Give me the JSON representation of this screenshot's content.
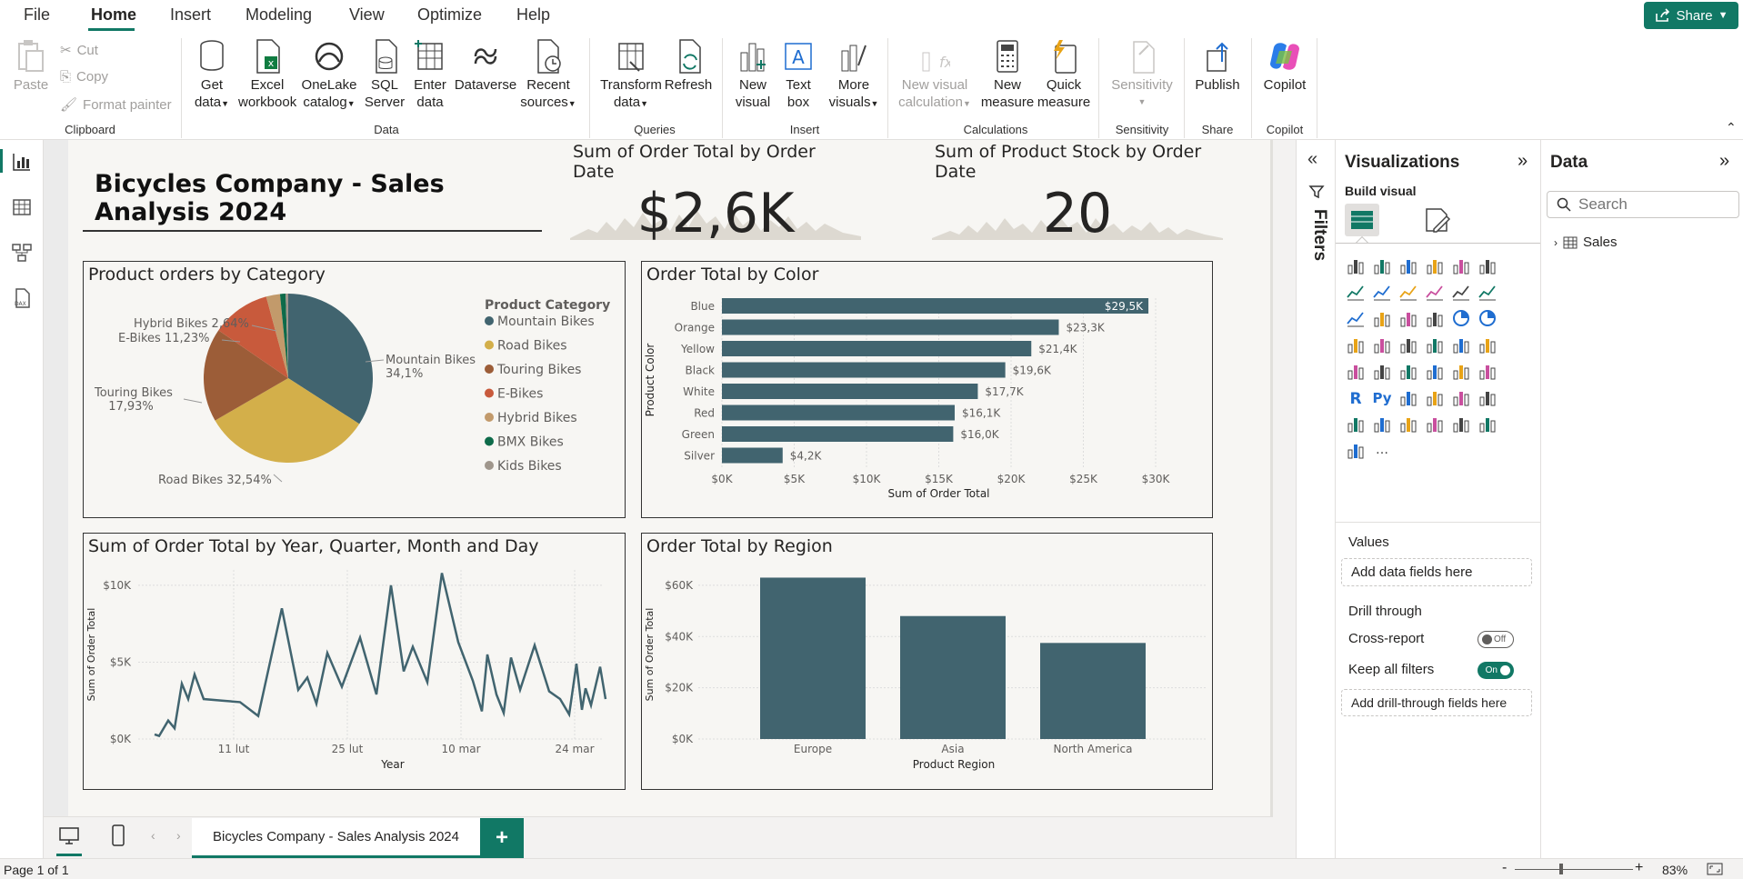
{
  "menu": {
    "file": "File",
    "home": "Home",
    "insert": "Insert",
    "modeling": "Modeling",
    "view": "View",
    "optimize": "Optimize",
    "help": "Help",
    "share": "Share"
  },
  "ribbon": {
    "paste": "Paste",
    "cut": "Cut",
    "copy": "Copy",
    "format_painter": "Format painter",
    "get_data": [
      "Get",
      "data"
    ],
    "excel": [
      "Excel",
      "workbook"
    ],
    "onelake": [
      "OneLake",
      "catalog"
    ],
    "sql": [
      "SQL",
      "Server"
    ],
    "enter": [
      "Enter",
      "data"
    ],
    "dataverse": "Dataverse",
    "recent": [
      "Recent",
      "sources"
    ],
    "transform": [
      "Transform",
      "data"
    ],
    "refresh": "Refresh",
    "new_visual": [
      "New",
      "visual"
    ],
    "text_box": [
      "Text",
      "box"
    ],
    "more_visuals": [
      "More",
      "visuals"
    ],
    "new_visual_calc": [
      "New visual",
      "calculation"
    ],
    "new_measure": [
      "New",
      "measure"
    ],
    "quick_measure": [
      "Quick",
      "measure"
    ],
    "sensitivity": "Sensitivity",
    "publish": "Publish",
    "copilot": "Copilot",
    "groups": {
      "clipboard": "Clipboard",
      "data": "Data",
      "queries": "Queries",
      "insert": "Insert",
      "calculations": "Calculations",
      "sensitivity": "Sensitivity",
      "share": "Share",
      "copilot": "Copilot"
    }
  },
  "report": {
    "title": "Bicycles Company - Sales Analysis 2024",
    "card1": {
      "title": "Sum of Order Total by Order Date",
      "value": "$2,6K"
    },
    "card2": {
      "title": "Sum of Product Stock by Order Date",
      "value": "20"
    },
    "pie_title": "Product orders by Category",
    "bar_title": "Order Total by Color",
    "line_title": "Sum of Order Total by Year, Quarter, Month and Day",
    "region_title": "Order Total by Region"
  },
  "chart_data": [
    {
      "type": "pie",
      "title": "Product orders by Category",
      "legend_title": "Product Category",
      "categories": [
        "Mountain Bikes",
        "Road Bikes",
        "Touring Bikes",
        "E-Bikes",
        "Hybrid Bikes",
        "BMX Bikes",
        "Kids Bikes"
      ],
      "values": [
        34.1,
        32.54,
        17.93,
        11.23,
        2.64,
        1.06,
        0.5
      ],
      "labels": [
        "Mountain Bikes 34,1%",
        "Road Bikes 32,54%",
        "Touring Bikes 17,93%",
        "E-Bikes 11,23%",
        "Hybrid Bikes 2,64%"
      ],
      "colors": [
        "#41646f",
        "#d3af4a",
        "#9c5d38",
        "#c85a3c",
        "#c29a6b",
        "#0e6b4a",
        "#9f968c"
      ],
      "legend": "right"
    },
    {
      "type": "bar",
      "orientation": "horizontal",
      "title": "Order Total by Color",
      "categories": [
        "Blue",
        "Orange",
        "Yellow",
        "Black",
        "White",
        "Red",
        "Green",
        "Silver"
      ],
      "values": [
        29.5,
        23.3,
        21.4,
        19.6,
        17.7,
        16.1,
        16.0,
        4.2
      ],
      "labels": [
        "$29,5K",
        "$23,3K",
        "$21,4K",
        "$19,6K",
        "$17,7K",
        "$16,1K",
        "$16,0K",
        "$4,2K"
      ],
      "xlabel": "Sum of Order Total",
      "ylabel": "Product Color",
      "xticks": [
        "$0K",
        "$5K",
        "$10K",
        "$15K",
        "$20K",
        "$25K",
        "$30K"
      ],
      "xlim": [
        0,
        30
      ]
    },
    {
      "type": "line",
      "title": "Sum of Order Total by Year, Quarter, Month and Day",
      "x": [
        1,
        2,
        3,
        4,
        5,
        6,
        7,
        8,
        9,
        10,
        11,
        12,
        13,
        14,
        15,
        16,
        17,
        18,
        19,
        20,
        21,
        22,
        23,
        24,
        25,
        26,
        27,
        28,
        29,
        30,
        31,
        32,
        33,
        34,
        35,
        36,
        37,
        38,
        39,
        40,
        41,
        42,
        43,
        44
      ],
      "y": [
        0.3,
        0.2,
        1.2,
        0.7,
        3.6,
        2.6,
        4.2,
        2.6,
        2.5,
        2.4,
        1.5,
        8.5,
        3.2,
        4.0,
        2.3,
        5.6,
        3.4,
        6.6,
        2.9,
        10.0,
        4.4,
        6.0,
        3.7,
        10.8,
        6.3,
        3.8,
        1.8,
        5.5,
        2.9,
        1.7,
        5.3,
        3.2,
        6.1,
        3.1,
        2.6,
        1.6,
        4.9,
        1.9,
        3.3,
        2.2,
        4.7,
        2.6
      ],
      "xlabel": "Year",
      "ylabel": "Sum of Order Total",
      "xticks": [
        "11 lut",
        "25 lut",
        "10 mar",
        "24 mar"
      ],
      "yticks": [
        "$0K",
        "$5K",
        "$10K"
      ],
      "ylim": [
        0,
        11
      ]
    },
    {
      "type": "bar",
      "title": "Order Total by Region",
      "categories": [
        "Europe",
        "Asia",
        "North America"
      ],
      "values": [
        63,
        48,
        37.5
      ],
      "xlabel": "Product Region",
      "ylabel": "Sum of Order Total",
      "yticks": [
        "$0K",
        "$20K",
        "$40K",
        "$60K"
      ],
      "ylim": [
        0,
        66
      ]
    }
  ],
  "colors": {
    "accent": "#117865",
    "bar": "#41646f"
  },
  "filters": {
    "label": "Filters"
  },
  "viz": {
    "title": "Visualizations",
    "build_visual": "Build visual",
    "values": "Values",
    "add_fields": "Add data fields here",
    "drill_through": "Drill through",
    "cross_report": "Cross-report",
    "cross_state": "Off",
    "keep_filters": "Keep all filters",
    "keep_state": "On",
    "add_drill": "Add drill-through fields here"
  },
  "data_pane": {
    "title": "Data",
    "search_placeholder": "Search",
    "table": "Sales"
  },
  "pages": {
    "tab": "Bicycles Company - Sales Analysis 2024",
    "add": "+"
  },
  "status": {
    "page": "Page 1 of 1",
    "zoom": "83%",
    "minus": "-",
    "plus": "+"
  }
}
